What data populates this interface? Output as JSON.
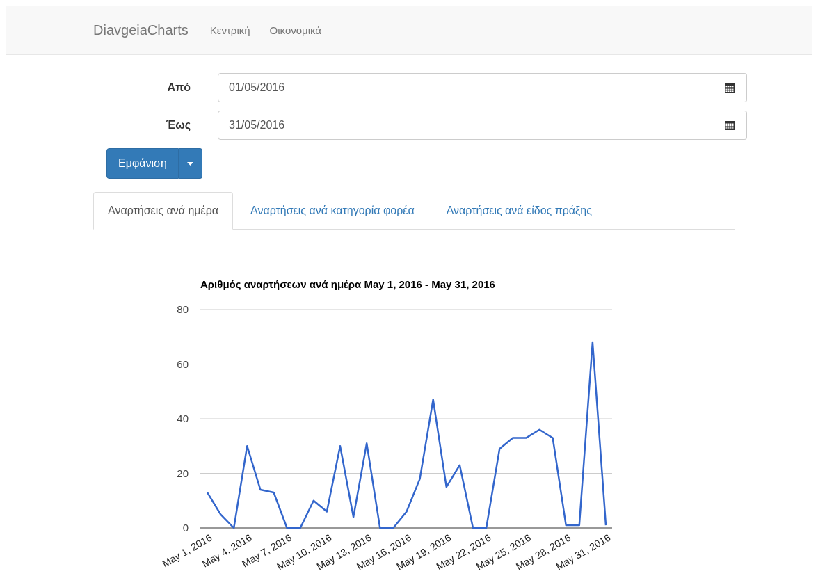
{
  "navbar": {
    "brand": "DiavgeiaCharts",
    "links": [
      {
        "label": "Κεντρική",
        "selected": false
      },
      {
        "label": "Οικονομικά",
        "selected": false
      }
    ]
  },
  "form": {
    "fields": [
      {
        "label": "Από",
        "value": "01/05/2016"
      },
      {
        "label": "Έως",
        "value": "31/05/2016"
      }
    ],
    "submit": "Εμφάνιση"
  },
  "tabs": [
    {
      "label": "Αναρτήσεις ανά ημέρα",
      "selected": true
    },
    {
      "label": "Αναρτήσεις ανά κατηγορία φορέα",
      "selected": false
    },
    {
      "label": "Αναρτήσεις ανά είδος πράξης",
      "selected": false
    }
  ],
  "chart": {
    "chart_data": {
      "type": "line",
      "title": "Αριθμός αναρτήσεων ανά ημέρα May 1, 2016 - May 31, 2016",
      "categories": [
        "May 1, 2016",
        null,
        null,
        "May 4, 2016",
        null,
        null,
        "May 7, 2016",
        null,
        null,
        "May 10, 2016",
        null,
        null,
        "May 13, 2016",
        null,
        null,
        "May 16, 2016",
        null,
        null,
        "May 19, 2016",
        null,
        null,
        "May 22, 2016",
        null,
        null,
        "May 25, 2016",
        null,
        null,
        "May 28, 2016",
        null,
        null,
        "May 31, 2016"
      ],
      "series": [
        {
          "color": "#3366cc",
          "values": [
            13,
            5,
            0,
            30,
            14,
            13,
            0,
            0,
            10,
            6,
            30,
            4,
            31,
            0,
            0,
            6,
            18,
            47,
            15,
            23,
            0,
            0,
            29,
            33,
            33,
            36,
            33,
            1,
            1,
            68,
            1
          ]
        }
      ],
      "ylim": [
        0,
        80
      ],
      "yticks": [
        0,
        20,
        40,
        60,
        80
      ],
      "grid": true
    }
  }
}
